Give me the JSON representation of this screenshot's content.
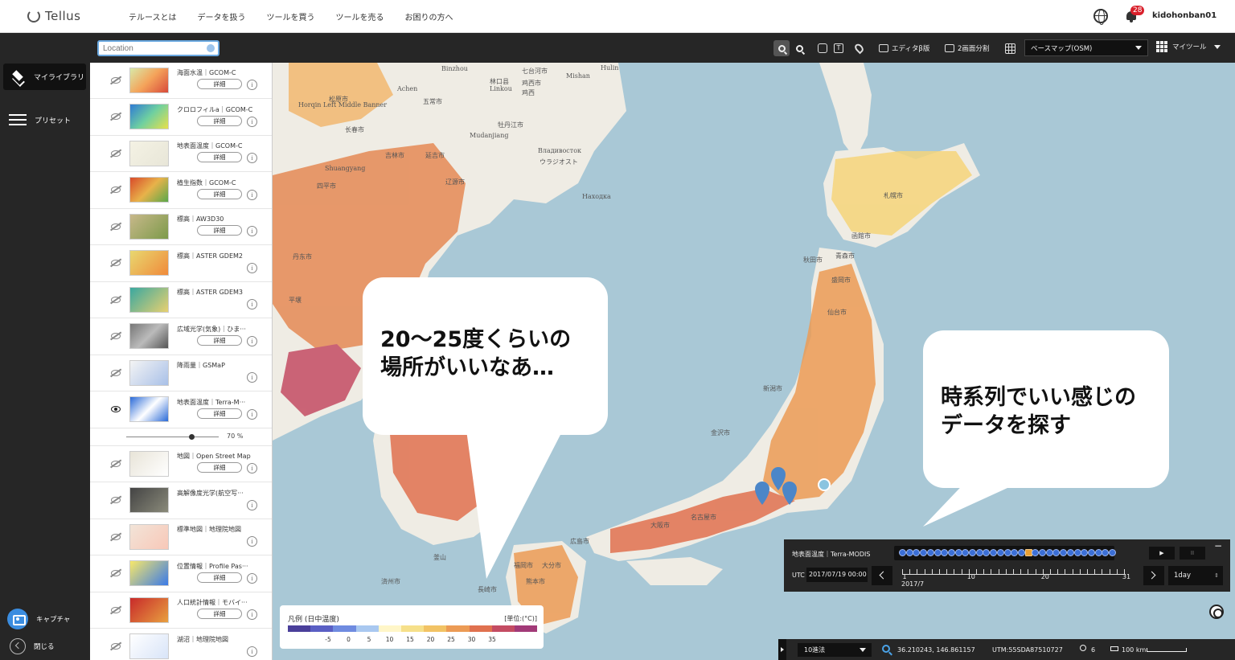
{
  "header": {
    "logo": "Tellus",
    "nav": [
      "テルースとは",
      "データを扱う",
      "ツールを買う",
      "ツールを売る",
      "お困りの方へ"
    ],
    "notification_count": "28",
    "username": "kidohonban01"
  },
  "toolbar": {
    "search_placeholder": "Location",
    "editor_label": "エディタβ版",
    "split_label": "2画面分割",
    "basemap_value": "ベースマップ(OSM)",
    "mytool_label": "マイツール"
  },
  "leftnav": {
    "mylibrary": "マイライブラリ",
    "preset": "プリセット",
    "capture": "キャプチャ",
    "close": "閉じる"
  },
  "layers": [
    {
      "name": "海面水温｜GCOM-C",
      "detail": "詳細",
      "visible": false
    },
    {
      "name": "クロロフィルa｜GCOM-C",
      "detail": "詳細",
      "visible": false
    },
    {
      "name": "地表面温度｜GCOM-C",
      "detail": "詳細",
      "visible": false
    },
    {
      "name": "植生指数｜GCOM-C",
      "detail": "詳細",
      "visible": false
    },
    {
      "name": "標高｜AW3D30",
      "detail": "詳細",
      "visible": false
    },
    {
      "name": "標高｜ASTER GDEM2",
      "detail": "",
      "visible": false
    },
    {
      "name": "標高｜ASTER GDEM3",
      "detail": "",
      "visible": false
    },
    {
      "name": "広域光学(気象)｜ひま···",
      "detail": "詳細",
      "visible": false
    },
    {
      "name": "降雨量｜GSMaP",
      "detail": "",
      "visible": false
    },
    {
      "name": "地表面温度｜Terra-M···",
      "detail": "詳細",
      "visible": true
    },
    {
      "name": "地図｜Open Street Map",
      "detail": "詳細",
      "visible": false
    },
    {
      "name": "高解像度光学(航空写···",
      "detail": "",
      "visible": false
    },
    {
      "name": "標準地図｜地理院地図",
      "detail": "",
      "visible": false
    },
    {
      "name": "位置情報｜Profile Pas···",
      "detail": "詳細",
      "visible": false
    },
    {
      "name": "人口統計情報｜モバイ···",
      "detail": "詳細",
      "visible": false
    },
    {
      "name": "湖沼｜地理院地図",
      "detail": "",
      "visible": false
    }
  ],
  "opacity": {
    "value": 70,
    "label": "70 %"
  },
  "bubbles": {
    "left": [
      "20〜25度くらいの",
      "場所がいいなあ…"
    ],
    "right": [
      "時系列でいい感じの",
      "データを探す"
    ]
  },
  "legend": {
    "title": "凡例 (日中温度)",
    "unit": "[単位:(°C)]",
    "ticks": [
      "-5",
      "0",
      "5",
      "10",
      "15",
      "20",
      "25",
      "30",
      "35"
    ],
    "colors": [
      "#4a3f9a",
      "#5a5fc4",
      "#6f8be0",
      "#a9c8f0",
      "#fff6c8",
      "#f6e08a",
      "#f2c365",
      "#ec9b55",
      "#e0714f",
      "#c44c63",
      "#a23a78"
    ]
  },
  "time_panel": {
    "layer": "地表面温度｜Terra-MODIS",
    "utc_label": "UTC",
    "utc_value": "2017/07/19 00:00",
    "month": "2017/7",
    "ruler_labels": [
      "1",
      "10",
      "20",
      "31"
    ],
    "days": 31,
    "selected_day": 19,
    "step": "1day",
    "play": "▶",
    "pause": "II",
    "minimize": "−"
  },
  "statusbar": {
    "crs": "10進法",
    "coords": "36.210243, 146.861157",
    "utm": "UTM:55SDA87510727",
    "zoom": "6",
    "scale": "100 km"
  },
  "map_labels": [
    "Binzhou",
    "Hulin",
    "Mishan",
    "七台河市",
    "林口县",
    "Linkou",
    "鸡西市",
    "鸡西",
    "Achen",
    "五常市",
    "松原市",
    "Horqin Left Middle Banner",
    "长春市",
    "牡丹江市",
    "Mudanjiang",
    "Владивосток",
    "ウラジオスト",
    "吉林市",
    "延吉市",
    "Shuangyang",
    "Находка",
    "四平市",
    "辽源市",
    "丹东市",
    "平壌",
    "仙台市",
    "秋田市",
    "新潟市",
    "金沢市",
    "名古屋市",
    "大阪市",
    "広島市",
    "福岡市",
    "熊本市",
    "大分市",
    "長崎市",
    "済州市",
    "釜山",
    "札幌市",
    "函館市",
    "青森市",
    "盛岡市"
  ]
}
